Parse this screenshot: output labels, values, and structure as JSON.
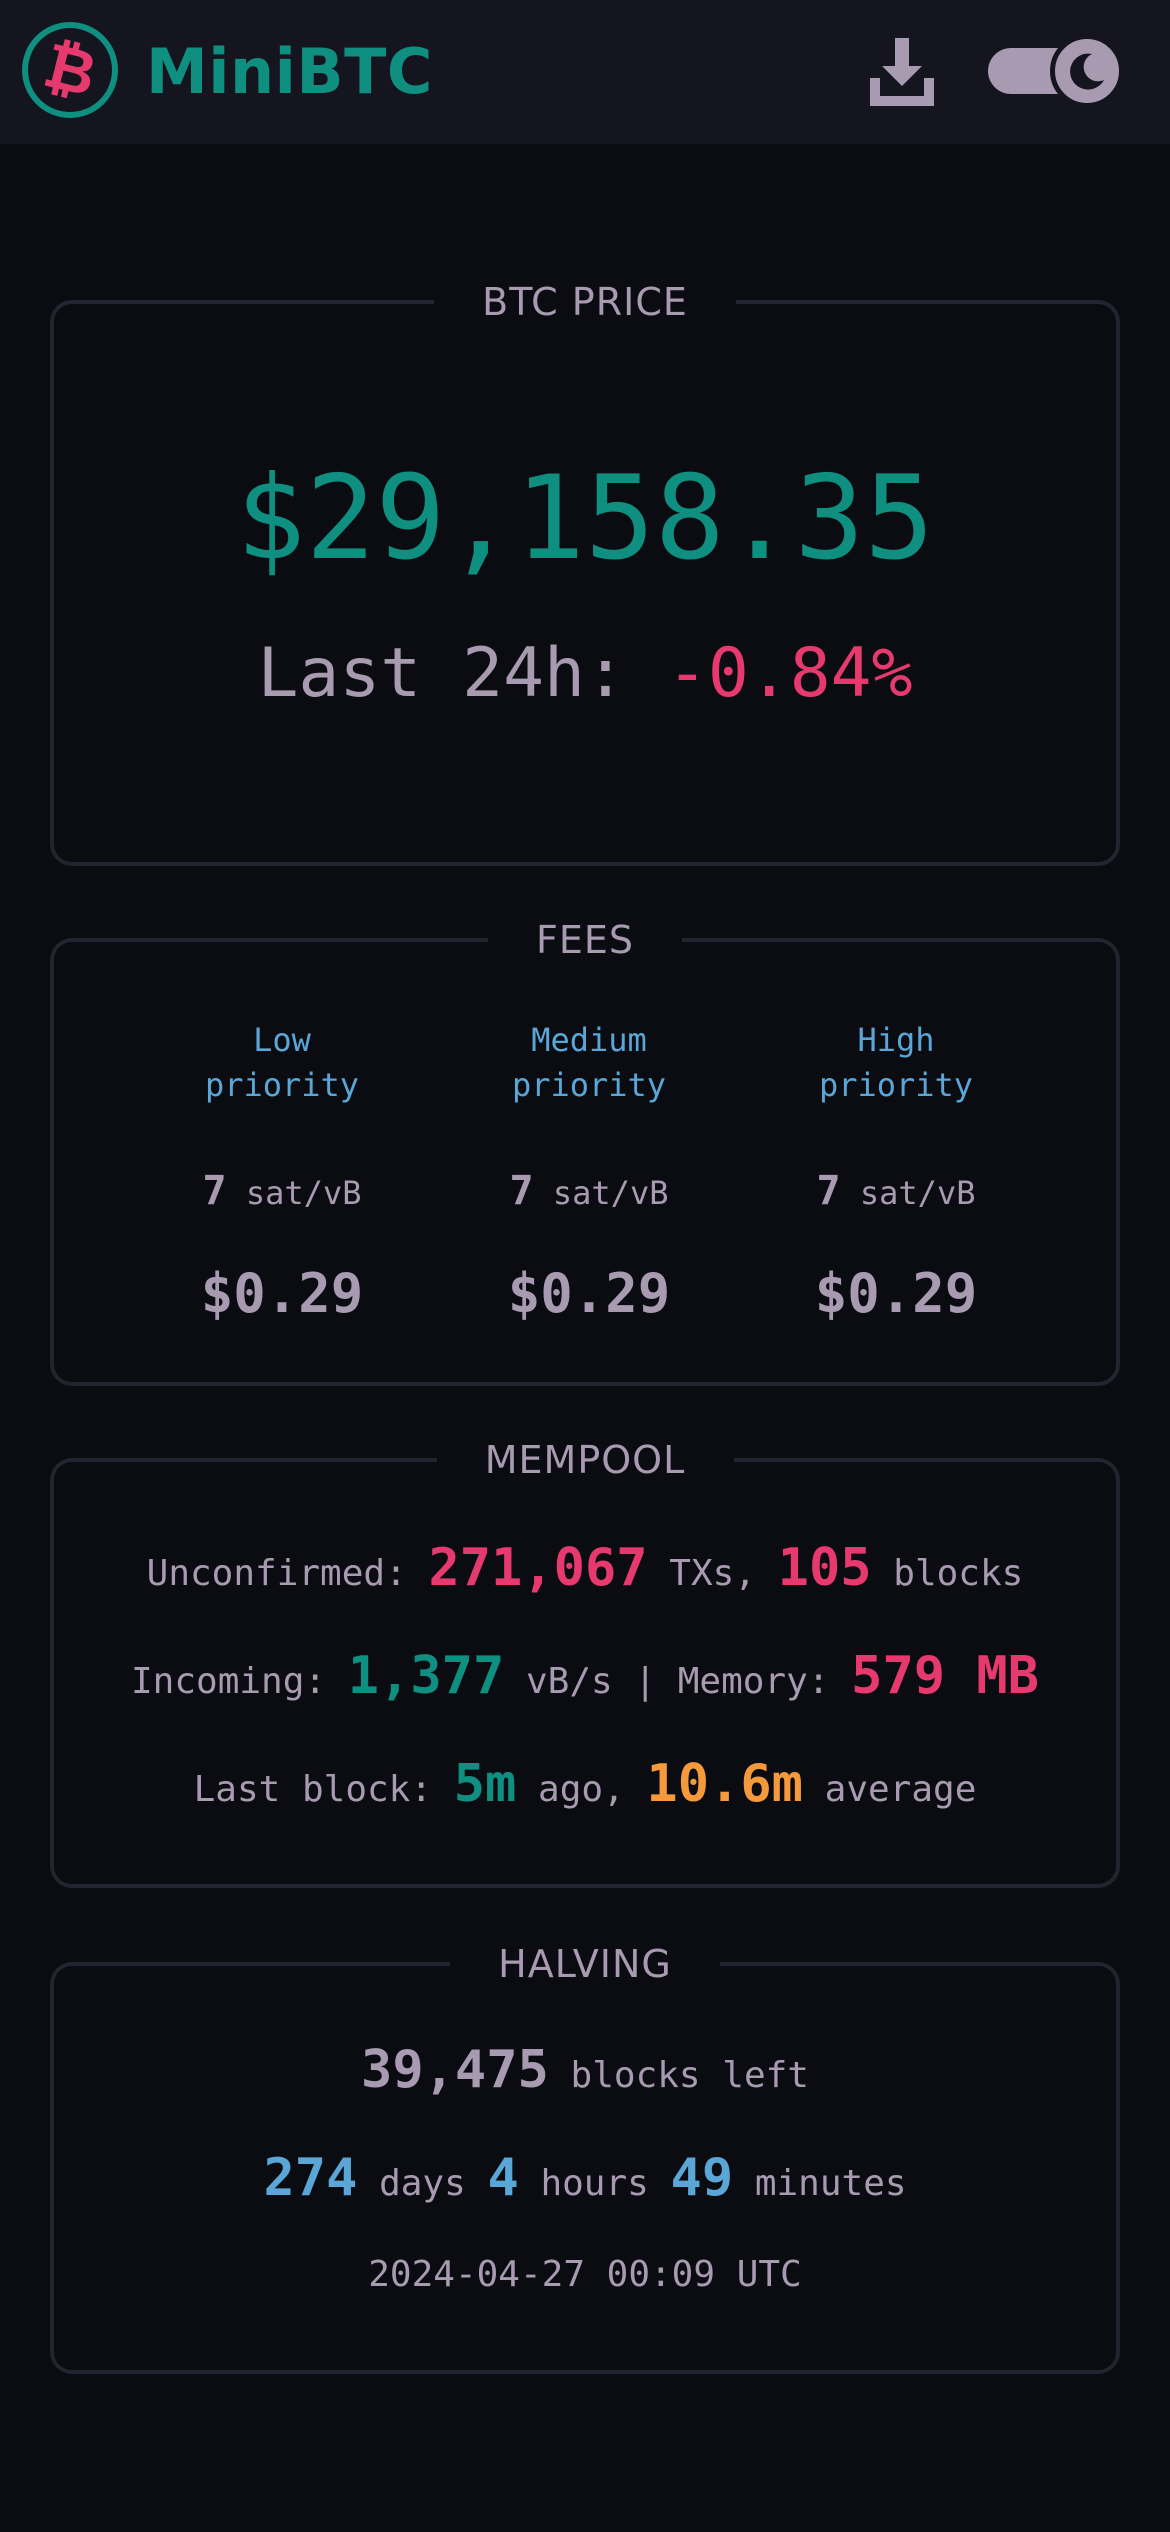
{
  "app": {
    "title": "MiniBTC",
    "logo_glyph": "₿",
    "colors": {
      "background": "#0b0c12",
      "header": "#14151f",
      "accent": "#0f8f80",
      "negative": "#e63a6e",
      "info": "#5aa6d6",
      "warning": "#f59a3c",
      "muted": "#a89ab0"
    },
    "icons": [
      "bitcoin-logo-icon",
      "download-icon",
      "moon-icon"
    ]
  },
  "price": {
    "legend": "BTC PRICE",
    "value": "$29,158.35",
    "change_label": "Last 24h:",
    "change_value": "-0.84%"
  },
  "fees": {
    "legend": "FEES",
    "unit": "sat/vB",
    "tiers": [
      {
        "label_line1": "Low",
        "label_line2": "priority",
        "rate": "7",
        "usd": "$0.29"
      },
      {
        "label_line1": "Medium",
        "label_line2": "priority",
        "rate": "7",
        "usd": "$0.29"
      },
      {
        "label_line1": "High",
        "label_line2": "priority",
        "rate": "7",
        "usd": "$0.29"
      }
    ]
  },
  "mempool": {
    "legend": "MEMPOOL",
    "unconfirmed_label": "Unconfirmed:",
    "unconfirmed_txs": "271,067",
    "txs_label": "TXs,",
    "blocks": "105",
    "blocks_label": "blocks",
    "incoming_label": "Incoming:",
    "incoming_value": "1,377",
    "incoming_unit": "vB/s |",
    "memory_label": "Memory:",
    "memory_value": "579 MB",
    "last_block_label": "Last block:",
    "last_block_value": "5m",
    "ago_label": "ago,",
    "average_value": "10.6m",
    "average_label": "average"
  },
  "halving": {
    "legend": "HALVING",
    "blocks_left": "39,475",
    "blocks_left_label": "blocks left",
    "days": "274",
    "days_label": "days",
    "hours": "4",
    "hours_label": "hours",
    "minutes": "49",
    "minutes_label": "minutes",
    "date": "2024-04-27 00:09 UTC"
  }
}
